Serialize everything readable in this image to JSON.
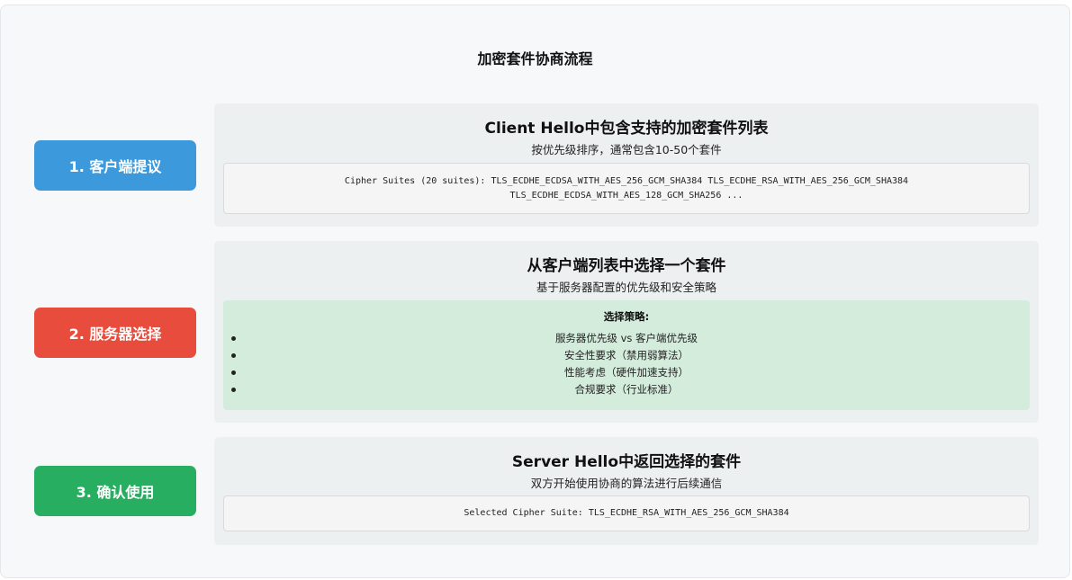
{
  "title": "加密套件协商流程",
  "steps": [
    {
      "label": "1. 客户端提议",
      "color": "#3b99dc",
      "heading": "Client Hello中包含支持的加密套件列表",
      "subheading": "按优先级排序，通常包含10-50个套件",
      "code": "Cipher Suites (20 suites): TLS_ECDHE_ECDSA_WITH_AES_256_GCM_SHA384 TLS_ECDHE_RSA_WITH_AES_256_GCM_SHA384 TLS_ECDHE_ECDSA_WITH_AES_128_GCM_SHA256 ..."
    },
    {
      "label": "2. 服务器选择",
      "color": "#e74c3c",
      "heading": "从客户端列表中选择一个套件",
      "subheading": "基于服务器配置的优先级和安全策略",
      "strategy_title": "选择策略:",
      "strategies": [
        "服务器优先级 vs 客户端优先级",
        "安全性要求（禁用弱算法）",
        "性能考虑（硬件加速支持）",
        "合规要求（行业标准）"
      ]
    },
    {
      "label": "3. 确认使用",
      "color": "#27ae60",
      "heading": "Server Hello中返回选择的套件",
      "subheading": "双方开始使用协商的算法进行后续通信",
      "code": "Selected Cipher Suite: TLS_ECDHE_RSA_WITH_AES_256_GCM_SHA384"
    }
  ],
  "colors": {
    "background": "#f7f8fa",
    "panel": "#edf0f1",
    "code_box": "#f5f5f5",
    "strategy_box": "#d4ecdc"
  }
}
